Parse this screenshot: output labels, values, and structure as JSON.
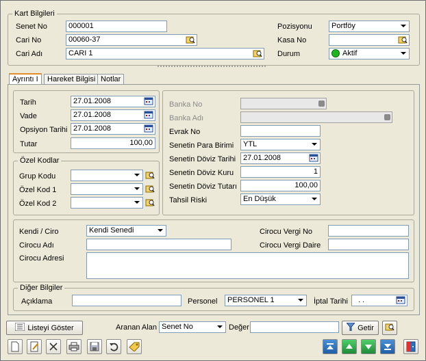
{
  "kart": {
    "title": "Kart Bilgileri",
    "senet_no_label": "Senet No",
    "senet_no_value": "000001",
    "cari_no_label": "Cari No",
    "cari_no_value": "00060-37",
    "cari_adi_label": "Cari Adı",
    "cari_adi_value": "CARI 1",
    "pozisyonu_label": "Pozisyonu",
    "pozisyonu_value": "Portföy",
    "kasa_no_label": "Kasa No",
    "kasa_no_value": "",
    "durum_label": "Durum",
    "durum_value": "Aktif"
  },
  "tabs": [
    "Ayrıntı I",
    "Hareket Bilgisi",
    "Notlar"
  ],
  "dates": {
    "tarih_label": "Tarih",
    "tarih_value": "27.01.2008",
    "vade_label": "Vade",
    "vade_value": "27.01.2008",
    "opsiyon_label": "Opsiyon Tarihi",
    "opsiyon_value": "27.01.2008",
    "tutar_label": "Tutar",
    "tutar_value": "100,00"
  },
  "ozel": {
    "title": "Özel Kodlar",
    "grup_label": "Grup Kodu",
    "kod1_label": "Özel Kod 1",
    "kod2_label": "Özel Kod 2"
  },
  "bank": {
    "banka_no_label": "Banka No",
    "banka_adi_label": "Banka Adı",
    "evrak_no_label": "Evrak No",
    "evrak_no_value": "",
    "para_label": "Senetin Para Birimi",
    "para_value": "YTL",
    "doviz_tarih_label": "Senetin Döviz Tarihi",
    "doviz_tarih_value": "27.01.2008",
    "doviz_kuru_label": "Senetin Döviz Kuru",
    "doviz_kuru_value": "1",
    "doviz_tutar_label": "Senetin Döviz Tutarı",
    "doviz_tutar_value": "100,00",
    "tahsil_label": "Tahsil Riski",
    "tahsil_value": "En Düşük"
  },
  "ciro": {
    "kendi_label": "Kendi / Ciro",
    "kendi_value": "Kendi Senedi",
    "cirocu_adi_label": "Cirocu Adı",
    "cirocu_adresi_label": "Cirocu Adresi",
    "vergi_no_label": "Cirocu Vergi No",
    "vergi_daire_label": "Cirocu Vergi Daire"
  },
  "diger": {
    "title": "Diğer Bilgiler",
    "aciklama_label": "Açıklama",
    "personel_label": "Personel",
    "personel_value": "PERSONEL 1",
    "iptal_label": "İptal Tarihi",
    "iptal_value": ". ."
  },
  "search": {
    "listeyi_label": "Listeyi Göster",
    "aranan_label": "Aranan Alan",
    "aranan_value": "Senet No",
    "deger_label": "Değer",
    "getir_label": "Getir"
  }
}
